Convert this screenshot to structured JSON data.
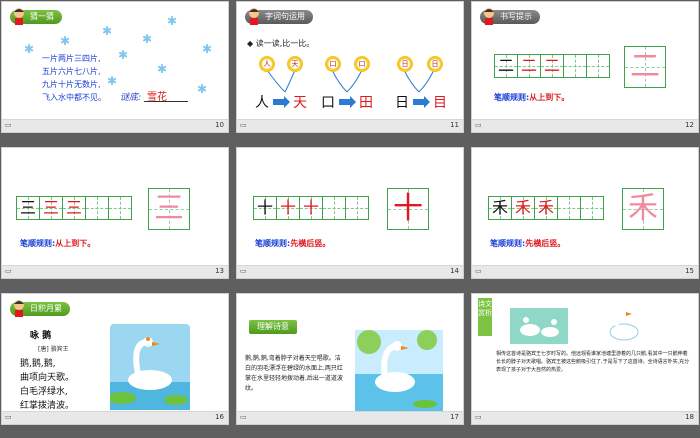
{
  "slides": [
    {
      "num": "10",
      "tab": "猜一猜",
      "riddle": [
        "一片两片三四片,",
        "五片六片七八片,",
        "九片十片无数片,",
        "飞入水中都不见。"
      ],
      "answer_label": "谜底:",
      "answer": "雪花"
    },
    {
      "num": "11",
      "tab": "字词句运用",
      "sub": "◆ 读一读,比一比。",
      "groups": [
        {
          "bubbles": [
            "人",
            "天"
          ],
          "from": "人",
          "to": "天"
        },
        {
          "bubbles": [
            "口",
            "口"
          ],
          "from": "口",
          "to": "田"
        },
        {
          "bubbles": [
            "日",
            "日"
          ],
          "from": "日",
          "to": "目"
        }
      ]
    },
    {
      "num": "12",
      "tab": "书写提示",
      "grid": [
        "二",
        "二",
        "二"
      ],
      "grid_red": [
        false,
        true,
        true
      ],
      "big": "二",
      "rule_label": "笔顺规则:",
      "rule_value": "从上到下。"
    },
    {
      "num": "13",
      "grid": [
        "三",
        "三",
        "三"
      ],
      "grid_red": [
        false,
        true,
        true
      ],
      "big": "三",
      "rule_label": "笔顺规则:",
      "rule_value": "从上到下。"
    },
    {
      "num": "14",
      "grid": [
        "十",
        "十",
        "十"
      ],
      "grid_red": [
        false,
        true,
        true
      ],
      "big": "十",
      "rule_label": "笔顺规则:",
      "rule_value": "先横后竖。"
    },
    {
      "num": "15",
      "grid": [
        "禾",
        "禾",
        "禾"
      ],
      "grid_red": [
        false,
        true,
        true
      ],
      "big": "禾",
      "rule_label": "笔顺规则:",
      "rule_value": "先横后竖。"
    },
    {
      "num": "16",
      "tab": "日积月累",
      "poem_title": "咏 鹅",
      "poem_author": "[唐] 骆宾王",
      "poem_lines": [
        "鹅,鹅,鹅,",
        "曲项向天歌。",
        "白毛浮绿水,",
        "红掌拨清波。"
      ]
    },
    {
      "num": "17",
      "tab": "理解诗意",
      "text": "鹅,鹅,鹅,弯着脖子对着天空唱歌。洁白的羽毛漂浮在碧绿的水面上,两只红掌在水里轻轻地拨动着,后出一道道波纹。"
    },
    {
      "num": "18",
      "tag": "诗文赏析",
      "text": "相传这首诗是骆宾王七岁时写的。他远观看谁家池塘里游着的几只鹅,看其中一只鹅伸着长长的脖子对天歌唱。骆宾王被这些鹅吸引住了,于是写下了这首诗。全诗语言朴实,充分表现了孩子对于大自然的热爱。"
    }
  ],
  "colors": {
    "background": "#5f5f5f",
    "grid": "#3fa14a",
    "red": "#e0191f",
    "blue": "#1a3fd4"
  }
}
